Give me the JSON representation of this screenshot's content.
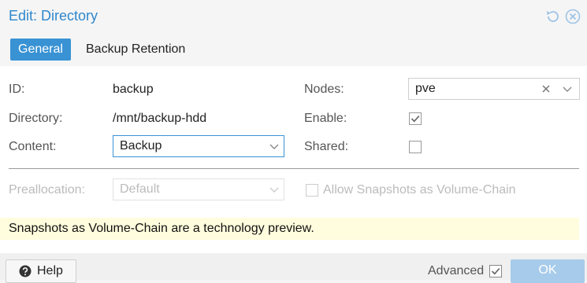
{
  "window": {
    "title": "Edit: Directory",
    "icons": {
      "reset": "reset-icon",
      "close": "close-icon"
    }
  },
  "tabs": [
    {
      "label": "General",
      "active": true
    },
    {
      "label": "Backup Retention",
      "active": false
    }
  ],
  "form": {
    "id": {
      "label": "ID:",
      "value": "backup"
    },
    "directory": {
      "label": "Directory:",
      "value": "/mnt/backup-hdd"
    },
    "content": {
      "label": "Content:",
      "value": "Backup"
    },
    "nodes": {
      "label": "Nodes:",
      "value": "pve"
    },
    "enable": {
      "label": "Enable:",
      "checked": true
    },
    "shared": {
      "label": "Shared:",
      "checked": false
    },
    "preallocation": {
      "label": "Preallocation:",
      "value": "Default",
      "disabled": true
    },
    "snapshots": {
      "label": "Allow Snapshots as Volume-Chain",
      "checked": false,
      "disabled": true
    }
  },
  "notice": {
    "text": "Snapshots as Volume-Chain are a technology preview."
  },
  "footer": {
    "help_label": "Help",
    "advanced_label": "Advanced",
    "advanced_checked": true,
    "ok_label": "OK"
  },
  "colors": {
    "accent": "#3892d4",
    "title": "#2e87cc",
    "ok_disabled": "#a7cbea",
    "notice_bg": "#fffddd"
  }
}
